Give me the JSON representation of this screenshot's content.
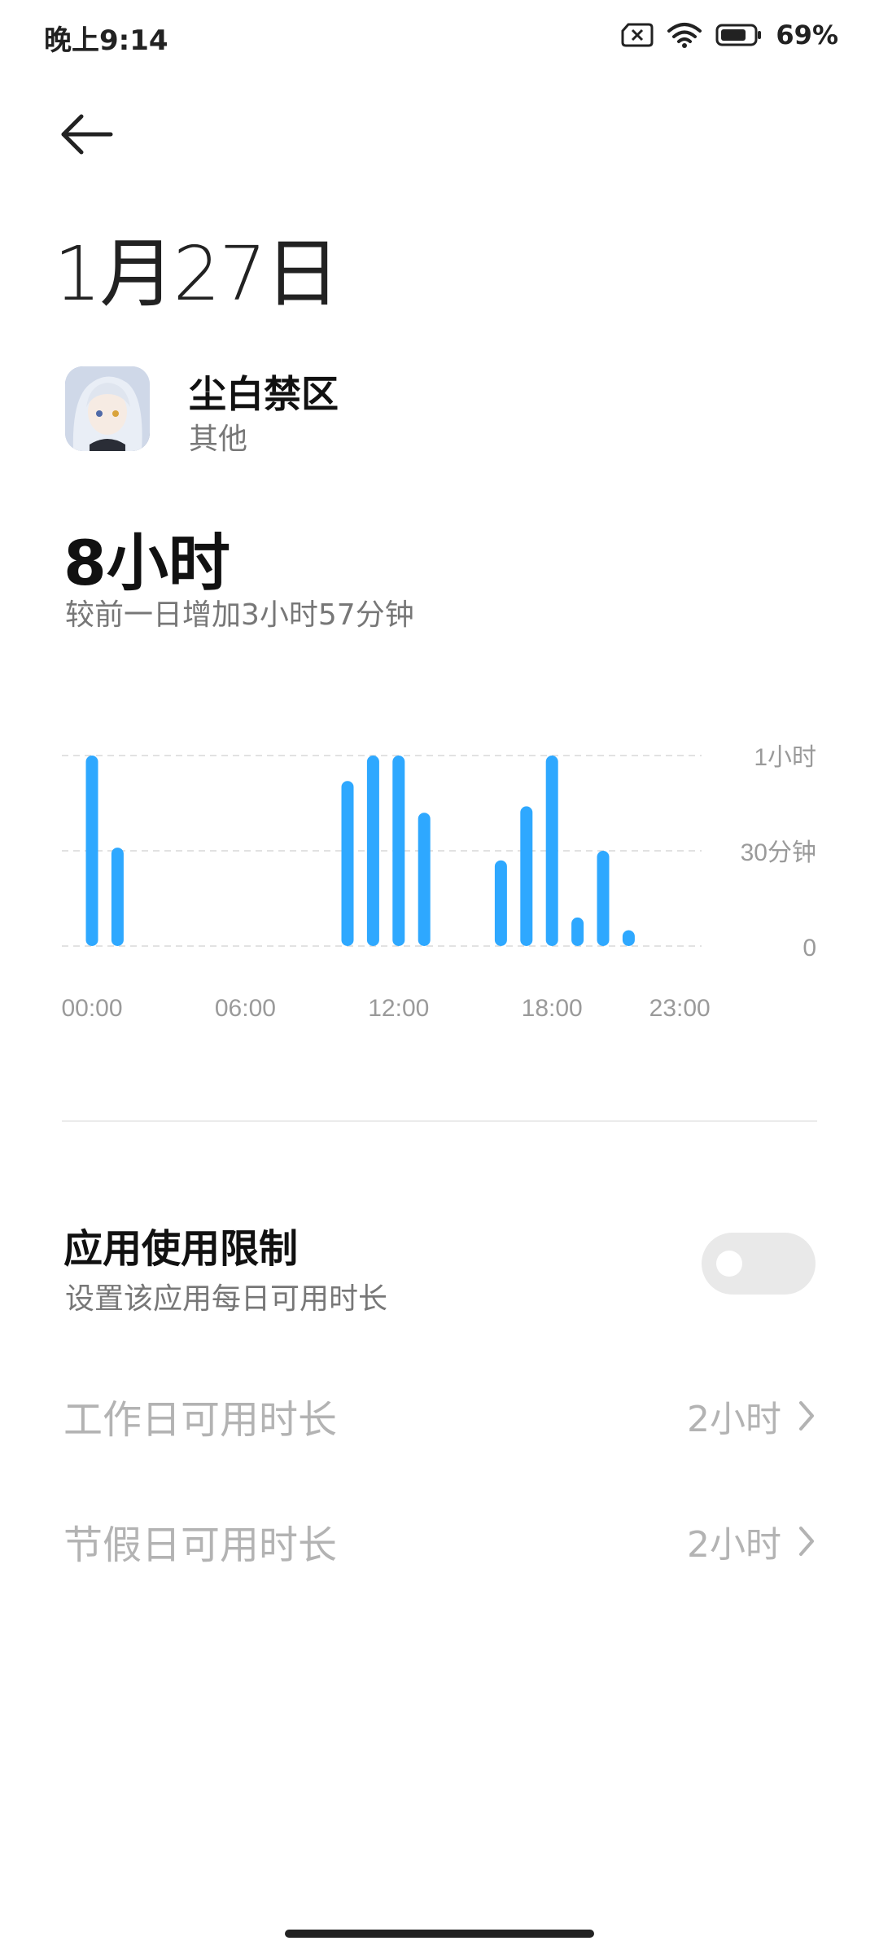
{
  "status_bar": {
    "time": "晚上9:14",
    "battery": "69%",
    "icons": [
      "no-sim-icon",
      "wifi-icon",
      "battery-icon"
    ]
  },
  "header": {
    "back_icon": "arrow-left-icon",
    "date": "1月27日"
  },
  "app": {
    "name": "尘白禁区",
    "category": "其他",
    "icon": "app-avatar-icon"
  },
  "usage": {
    "total": "8小时",
    "compare": "较前一日增加3小时57分钟"
  },
  "chart_data": {
    "type": "bar",
    "x_unit": "hour",
    "y_unit": "minutes",
    "x": [
      0,
      1,
      10,
      11,
      12,
      13,
      16,
      17,
      18,
      19,
      20,
      21
    ],
    "values": [
      60,
      31,
      52,
      60,
      60,
      42,
      27,
      44,
      60,
      9,
      30,
      5
    ],
    "ylim": [
      0,
      60
    ],
    "xlim": [
      0,
      23
    ],
    "x_tick_values": [
      0,
      6,
      12,
      18,
      23
    ],
    "x_tick_labels": [
      "00:00",
      "06:00",
      "12:00",
      "18:00",
      "23:00"
    ],
    "y_tick_values": [
      0,
      30,
      60
    ],
    "y_tick_labels": [
      "0",
      "30分钟",
      "1小时"
    ],
    "y_axis_position": "right",
    "grid": true,
    "bar_color": "#2ea8ff"
  },
  "limit": {
    "title": "应用使用限制",
    "subtitle": "设置该应用每日可用时长",
    "enabled": false
  },
  "rows": [
    {
      "label": "工作日可用时长",
      "value": "2小时",
      "icon": "chevron-right-icon"
    },
    {
      "label": "节假日可用时长",
      "value": "2小时",
      "icon": "chevron-right-icon"
    }
  ],
  "colors": {
    "accent": "#2ea8ff",
    "disabled_text": "#b3b3b3",
    "secondary_text": "#777777"
  }
}
